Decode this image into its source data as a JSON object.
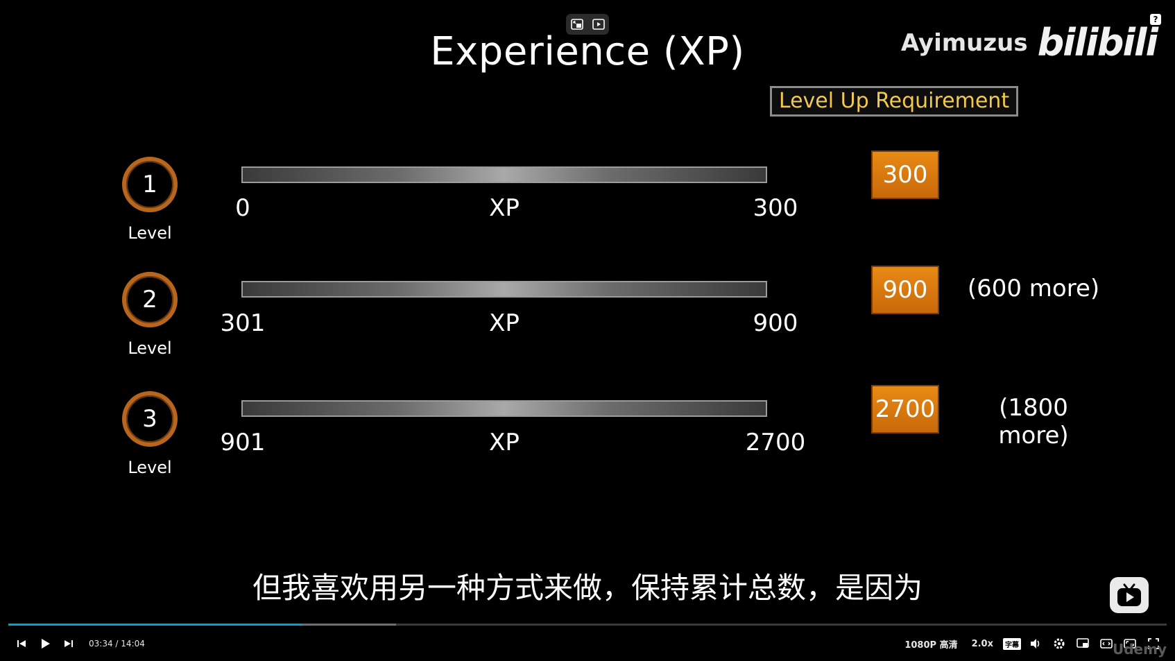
{
  "slide": {
    "title": "Experience (XP)",
    "requirement_header": "Level Up Requirement",
    "levels": [
      {
        "number": "1",
        "label": "Level",
        "start": "0",
        "axis": "XP",
        "end": "300",
        "requirement": "300",
        "more": ""
      },
      {
        "number": "2",
        "label": "Level",
        "start": "301",
        "axis": "XP",
        "end": "900",
        "requirement": "900",
        "more": "(600 more)"
      },
      {
        "number": "3",
        "label": "Level",
        "start": "901",
        "axis": "XP",
        "end": "2700",
        "requirement": "2700",
        "more": "(1800 more)"
      }
    ]
  },
  "watermark": {
    "name": "Ayimuzus",
    "logo": "bilibili",
    "help": "?"
  },
  "subtitle": "但我喜欢用另一种方式来做，保持累计总数，是因为",
  "player": {
    "current_time": "03:34",
    "separator": "/",
    "duration": "14:04",
    "progress_fraction": 0.254,
    "buffered_fraction": 0.335,
    "quality": "1080P 高清",
    "speed": "2.0x",
    "subtitle_btn": "字幕",
    "brand_corner": "Udemy",
    "accent_color": "#00a1d6"
  },
  "icons": {
    "top_left": "pip-icon",
    "top_right": "screenshot-icon",
    "prev": "skip-previous-icon",
    "play": "play-icon",
    "next": "skip-next-icon",
    "volume": "volume-icon",
    "settings": "gear-icon",
    "miniplayer": "miniplayer-icon",
    "widescreen": "widescreen-icon",
    "webfull": "web-fullscreen-icon",
    "fullscreen": "fullscreen-icon",
    "tv": "bilibili-tv-icon"
  }
}
